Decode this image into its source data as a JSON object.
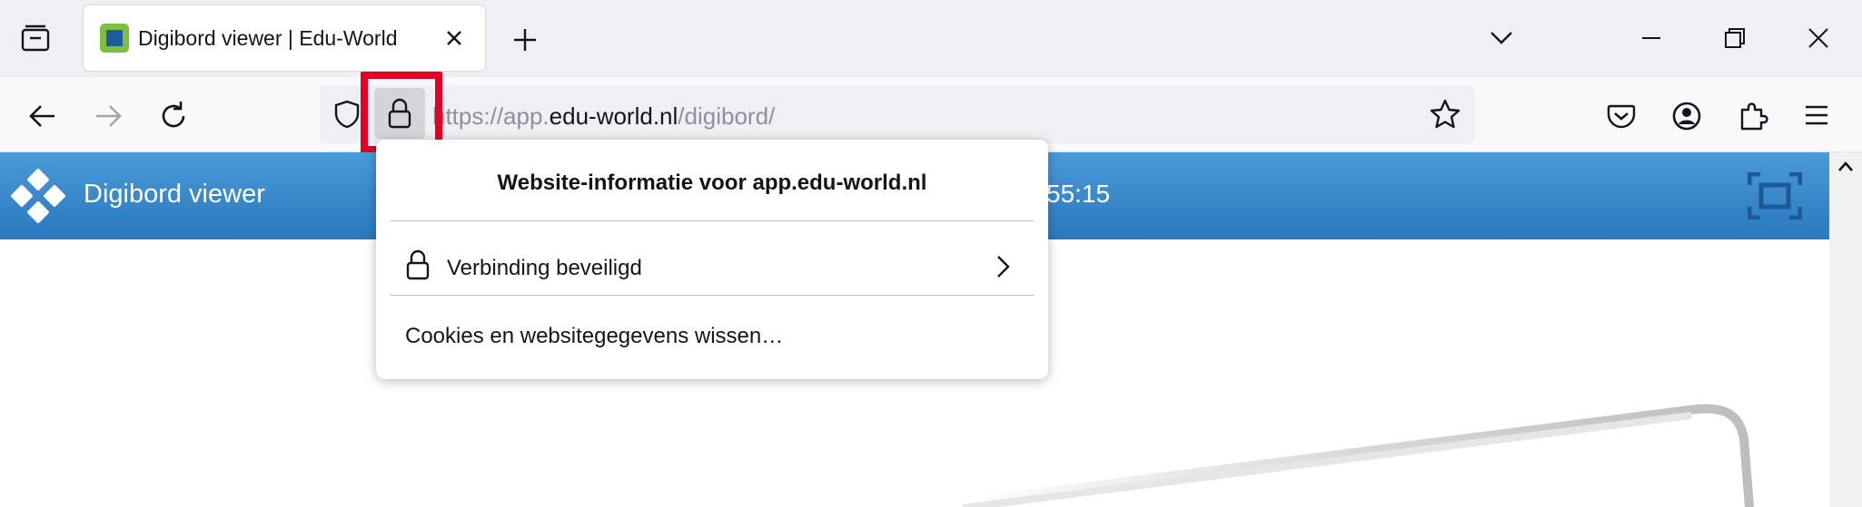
{
  "browser": {
    "tab": {
      "title": "Digibord viewer | Edu-World",
      "active": true
    },
    "url": {
      "scheme": "https://app.",
      "domain": "edu-world.nl",
      "path": "/digibord/"
    },
    "icons": {
      "tab_list": "tab-list-icon",
      "tab_close": "close-icon",
      "new_tab": "plus-icon",
      "tabs_dropdown": "chevron-down-icon",
      "back": "arrow-left-icon",
      "forward": "arrow-right-icon",
      "reload": "reload-icon",
      "tracking": "shield-icon",
      "site_info": "lock-icon",
      "bookmark": "star-icon",
      "pocket": "pocket-icon",
      "account": "account-icon",
      "extensions": "puzzle-icon",
      "menu": "hamburger-icon"
    }
  },
  "page": {
    "brand": "Digibord viewer",
    "time": "55:15",
    "header_color": "#3a8bcf"
  },
  "site_info_popup": {
    "title": "Website-informatie voor app.edu-world.nl",
    "connection_label": "Verbinding beveiligd",
    "clear_cookies_label": "Cookies en websitegegevens wissen…"
  },
  "highlight_color": "#e60023"
}
